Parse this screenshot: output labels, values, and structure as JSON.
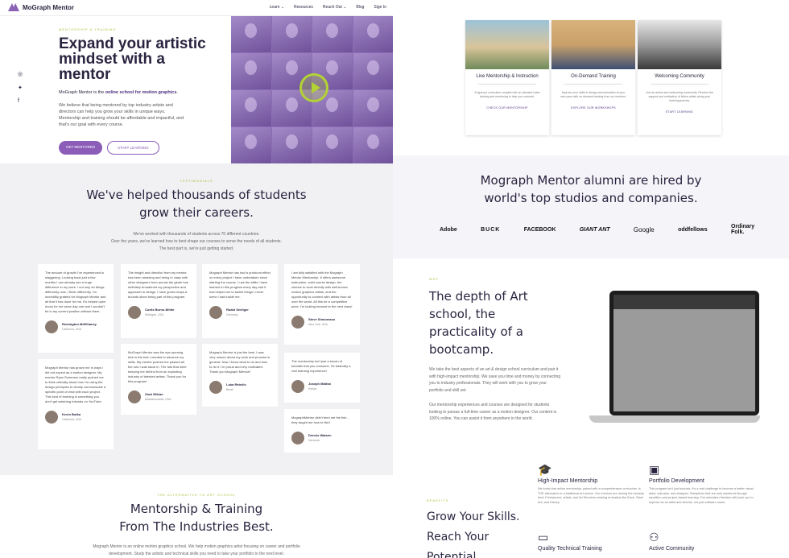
{
  "hero": {
    "logo": "MoGraph Mentor",
    "nav": [
      "Learn ⌄",
      "Resources",
      "Reach Out ⌄",
      "Blog",
      "Sign In"
    ],
    "eyebrow": "MENTORSHIP & TRAINING",
    "title": "Expand your artistic mindset with a mentor",
    "sub_pre": "MoGraph Mentor is the ",
    "sub_bold": "online school for motion graphics",
    "sub_post": ".",
    "body": "We believe that being mentored by top industry artists and directors can help you grow your skills in unique ways. Mentorship and training should be affordable and impactful, and that's our goal with every course.",
    "btn_primary": "GET MENTORED",
    "btn_secondary": "START LEARNING"
  },
  "cards": [
    {
      "title": "Live Mentorship & Instruction",
      "desc": "A rigorous curriculum coupled with on-demand video training and mentoring to help you succeed.",
      "link": "CHECK OUR MENTORSHIP"
    },
    {
      "title": "On-Demand Training",
      "desc": "Improve your skills in design and animation at your own pace with on-demand training from our mentors.",
      "link": "EXPLORE OUR WORKSHOPS"
    },
    {
      "title": "Welcoming Community",
      "desc": "Join an active and welcoming community. Receive the support and motivation of fellow artists along your learning journey.",
      "link": "START LEARNING"
    }
  ],
  "testimonials": {
    "eyebrow": "TESTIMONIALS",
    "title": "We've helped thousands of students grow their careers.",
    "sub1": "We've worked with thousands of students across 70 different countries.",
    "sub2": "Over the years, we've learned how to best shape our courses to serve the needs of all students.",
    "sub3": "The best part is, we're just getting started.",
    "items": [
      {
        "text": "The amount of growth I've experienced is staggering. Looking back just a few months I can already see a huge difference in my work. I not only do things differently now, I think differently. I'm incredibly grateful for Mograph Mentor and all that it has done for me. It's helped open doors for me since day one and I wouldn't be in my current position without them.",
        "name": "Remington McElhaney",
        "loc": "California, USA"
      },
      {
        "text": "The insight and direction from my mentor has been amazing and being in class with other designers from across the globe has definitely broadened my perspective and approach to design. I have grown leaps & bounds since being part of this program.",
        "name": "Curtis Burns-White",
        "loc": "Michigan, USA"
      },
      {
        "text": "Mograph Mentor has had a profound effect on every project I have undertaken since starting the course. I use the skills I have learned in this program every day and it has helped me to tackle things I never knew I had inside me.",
        "name": "Roald Seeliger",
        "loc": "Germany"
      },
      {
        "text": "I am fully satisfied with the Mograph Mentor Mentorship. It offers awesome instruction, solid course design, the chance to work directly with well-known motion graphics artists, and the opportunity to connect with artists from all over the world. All this for a competitive price. I'm looking forward to the next class!",
        "name": "Steve Simoneaux",
        "loc": "New York, USA"
      },
      {
        "text": "Mograph Mentor has grown me in ways I did not expect as a motion designer. My mentor Ryan Summers really pushed me to think critically about how I'm using the design principles to clearly communicate a specific point of view with each project. This kind of learning is something you don't get watching tutorials on YouTube.",
        "name": "Kevin Botka",
        "loc": "California, USA"
      },
      {
        "text": "MoGraph Mentor was the eye-opening kick in the butt I needed to advance my skills. My mentor pushed me passed all the ruts I was stuck in. The tuts that were keeping me behind from an exploding industry of talented artists. Thank you for this program!",
        "name": "Zack Milcan",
        "loc": "Massachusetts, USA"
      },
      {
        "text": "Mograph Mentor is just the best. I was very unsure about my work and process in general. Now I know what to do and how to do it. I'm proud and very motivated. Thank you Mograph Mentor!!",
        "name": "Luka Rebelic",
        "loc": "Brazil"
      },
      {
        "text": "The mentorship isn't just a bunch of tutorials that you consume, it's basically a real learning experience!",
        "name": "Joseph Mathai",
        "loc": "Kenya"
      },
      {
        "text": "MographMentor didn't feed me the fish - they taught me how to fish!",
        "name": "Dennis Watsen",
        "loc": "Denmark"
      }
    ]
  },
  "mtrain": {
    "eyebrow": "THE ALTERNATIVE TO ART SCHOOL",
    "title1": "Mentorship & Training",
    "title2": "From The Industries Best.",
    "body1": "Mograph Mentor is an online motion graphics school. We help motion graphics artist focusing on career and portfolio",
    "body2": "development. Study the artistic and technical skills you need to take your portfolio to the next level."
  },
  "alumni": {
    "title": "Mograph Mentor alumni are hired by world's top studios and companies.",
    "logos": [
      "Adobe",
      "BUCK",
      "FACEBOOK",
      "GIANT ANT",
      "Google",
      "oddfellows",
      "Ordinary Folk."
    ]
  },
  "art": {
    "eyebrow": "WHY",
    "title": "The depth of Art school, the practicality of a bootcamp.",
    "body1": "We take the best aspects of an art & design school curriculum and pair it with high-impact mentorship. We save you time and money by connecting you to industry professionals. They will work with you to grow your portfolio and skill set.",
    "body2": "Our mentorship experiences and courses are designed for students looking to pursue a full-time career as a motion designer. Our content is 100% online. You can assist it from anywhere in the world."
  },
  "grow": {
    "eyebrow": "BENEFITS",
    "title": "Grow Your Skills. Reach Your Potential.",
    "features": [
      {
        "icon": "mortarboard-icon",
        "title": "High-Impact Mentorship",
        "body": "We know that online mentorship, paired with a comprehensive curriculum, is THE alternative to a traditional Art school. Our mentors are among the industry best: Freelancers, artists, and Art Directors working at studios like Buck, Giant Ant, and Disney."
      },
      {
        "icon": "portfolio-icon",
        "title": "Portfolio Development",
        "body": "This program isn't just tutorials. It's a real challenge to become a better visual artist, animator, and designer. Disciplines that are only mastered through repetition and project-based learning. Our animation freedom will push you to improve as an artist and director, not just software users."
      },
      {
        "icon": "monitor-icon",
        "title": "Quality Technical Training",
        "body": ""
      },
      {
        "icon": "community-icon",
        "title": "Active Community",
        "body": ""
      }
    ]
  }
}
